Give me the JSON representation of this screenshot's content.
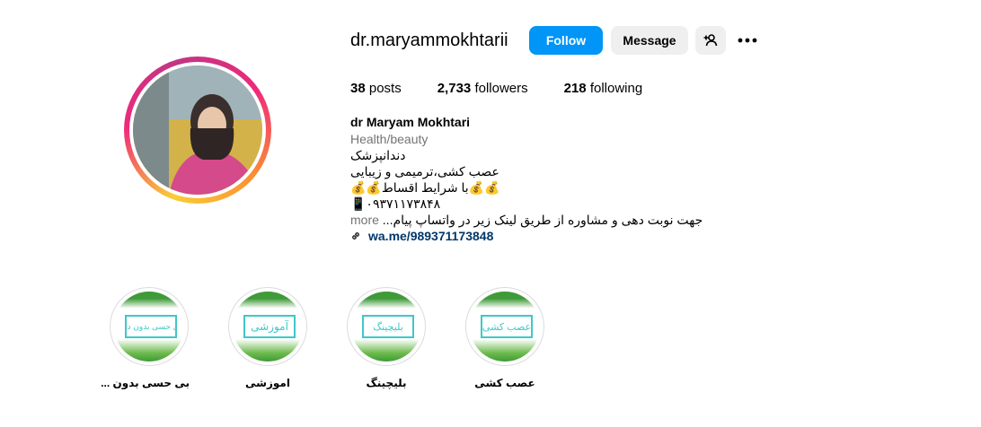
{
  "profile": {
    "username": "dr.maryammokhtarii",
    "follow_label": "Follow",
    "message_label": "Message",
    "add_user_icon": "person-add-icon",
    "more_icon": "more-options-icon",
    "accent_color": "#0095f6"
  },
  "stats": {
    "posts_count": "38",
    "posts_label": "posts",
    "followers_count": "2,733",
    "followers_label": "followers",
    "following_count": "218",
    "following_label": "following"
  },
  "bio": {
    "full_name": "dr Maryam Mokhtari",
    "category": "Health/beauty",
    "line1": "دندانپزشک",
    "line2": "عصب کشی،ترمیمی و زیبایی",
    "line3": "💰💰با شرایط اقساط💰💰",
    "line4": "📱۰۹۳۷۱۱۷۳۸۴۸",
    "line5": "جهت نوبت دهی و مشاوره از طریق لینک زیر در واتساپ پیام...",
    "more_label": "more",
    "link_text": "wa.me/989371173848"
  },
  "highlights": [
    {
      "label": "بی حسی بدون ...",
      "cover_text": "بی حسی بدون درد"
    },
    {
      "label": "اموزشی",
      "cover_text": "آموزشی"
    },
    {
      "label": "بلیچینگ",
      "cover_text": "بلیچینگ"
    },
    {
      "label": "عصب کشی",
      "cover_text": "عصب کشی"
    }
  ]
}
